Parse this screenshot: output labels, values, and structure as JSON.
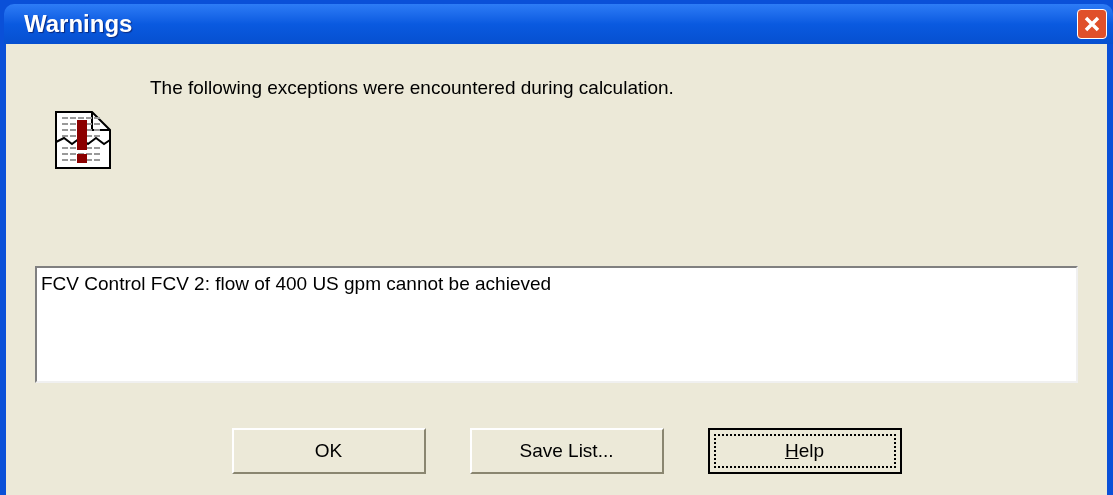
{
  "window": {
    "title": "Warnings"
  },
  "message": "The following exceptions were encountered during calculation.",
  "exceptions": [
    "FCV Control FCV 2: flow of 400 US gpm cannot be achieved"
  ],
  "buttons": [
    {
      "label": "OK",
      "focused": false
    },
    {
      "label": "Save List...",
      "focused": false
    },
    {
      "label": "Help",
      "focused": true,
      "first_letter_underlined": true
    }
  ]
}
